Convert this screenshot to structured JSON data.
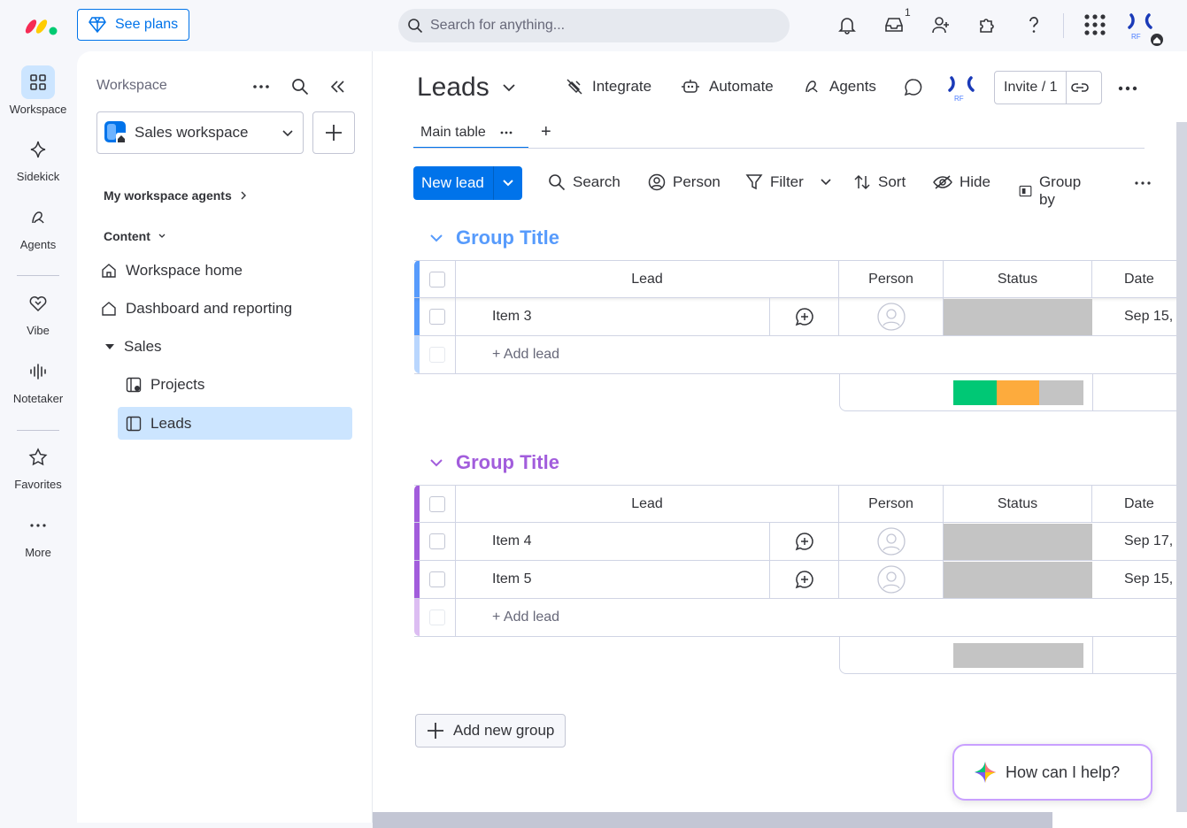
{
  "topbar": {
    "see_plans": "See plans",
    "search_placeholder": "Search for anything...",
    "notification_count": "1",
    "avatar_initials": "RF"
  },
  "rail": {
    "items": [
      {
        "label": "Workspace",
        "icon": "grid-icon"
      },
      {
        "label": "Sidekick",
        "icon": "sparkle-icon"
      },
      {
        "label": "Agents",
        "icon": "agents-icon"
      },
      {
        "label": "Vibe",
        "icon": "heart-icon"
      },
      {
        "label": "Notetaker",
        "icon": "soundwave-icon"
      },
      {
        "label": "Favorites",
        "icon": "star-icon"
      },
      {
        "label": "More",
        "icon": "more-icon"
      }
    ]
  },
  "sidebar": {
    "title": "Workspace",
    "workspace_name": "Sales workspace",
    "agents_section": "My workspace agents",
    "content_section": "Content",
    "links": {
      "home": "Workspace home",
      "dashboard": "Dashboard and reporting",
      "folder": "Sales",
      "projects": "Projects",
      "leads": "Leads"
    }
  },
  "board": {
    "title": "Leads",
    "integrate": "Integrate",
    "automate": "Automate",
    "agents": "Agents",
    "invite": "Invite / 1",
    "tab_main": "Main table",
    "tab_add": "+",
    "new_lead": "New lead",
    "toolbar": {
      "search": "Search",
      "person": "Person",
      "filter": "Filter",
      "sort": "Sort",
      "hide": "Hide",
      "group_by": "Group by"
    },
    "columns": {
      "lead": "Lead",
      "person": "Person",
      "status": "Status",
      "date": "Date"
    },
    "groups": [
      {
        "title": "Group Title",
        "color": "#579bfc",
        "items": [
          {
            "name": "Item 3",
            "date": "Sep 15, "
          }
        ],
        "add_label": "+ Add lead",
        "status_summary": [
          {
            "color": "#00c875",
            "fraction": 0.33
          },
          {
            "color": "#fdab3d",
            "fraction": 0.33
          },
          {
            "color": "#c4c4c4",
            "fraction": 0.34
          }
        ]
      },
      {
        "title": "Group Title",
        "color": "#a25ddc",
        "items": [
          {
            "name": "Item 4",
            "date": "Sep 17, "
          },
          {
            "name": "Item 5",
            "date": "Sep 15, "
          }
        ],
        "add_label": "+ Add lead",
        "status_summary": [
          {
            "color": "#c4c4c4",
            "fraction": 1.0
          }
        ]
      }
    ],
    "add_group": "Add new group",
    "help": "How can I help?"
  }
}
